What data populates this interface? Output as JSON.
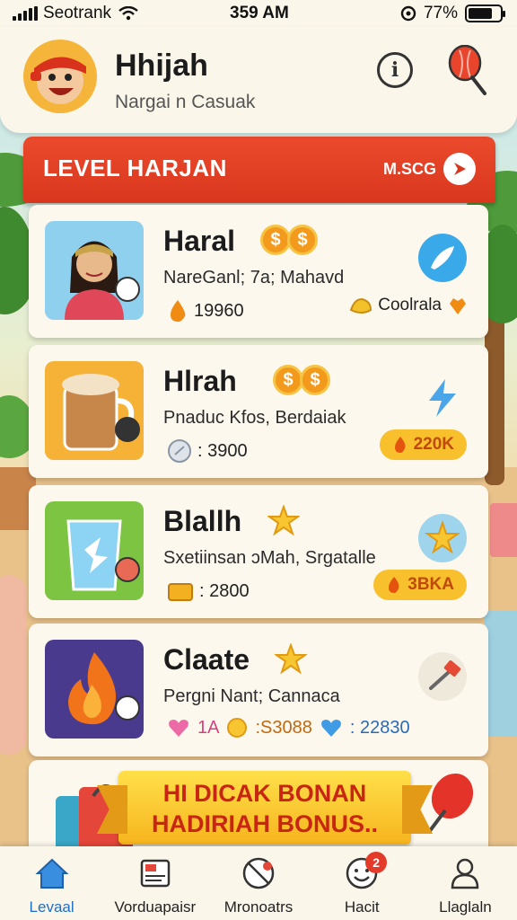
{
  "status_bar": {
    "carrier": "Seotrank",
    "time": "359 AM",
    "battery": "77%",
    "battery_level": 0.77
  },
  "header": {
    "title": "Hhijah",
    "subtitle": "Nargai n Casuak"
  },
  "level_banner": {
    "title": "LEVEL HARJAN",
    "more_label": "M.SCG"
  },
  "cards": [
    {
      "title": "Haral",
      "title_tokens": [
        "$",
        "$"
      ],
      "description": "NareGanl; 7a; Mahavd",
      "stat_value": "19960",
      "right_label": "Coolrala",
      "accent": "#2ea3e6"
    },
    {
      "title": "Hlrah",
      "title_tokens": [
        "$",
        "$"
      ],
      "description": "Pnaduc Kfos, Berdaiak",
      "stat_value": ": 3900",
      "right_label": "220K",
      "accent": "#f8c02c"
    },
    {
      "title": "Blallh",
      "description": "Sxetiinsan ɔMah, Srgatalle",
      "stat_value": ": 2800",
      "right_label": "3BKA",
      "accent": "#f8c02c"
    },
    {
      "title": "Claate",
      "description": "Pergni Nant; Cannaca",
      "stat_items": [
        "1A",
        ":S3088",
        ": 22830"
      ]
    }
  ],
  "bonus": {
    "line1": "HI DICAK BONAN",
    "line2": "HADIRIAH BONUS.."
  },
  "nav": [
    {
      "label": "Levaal",
      "active": true
    },
    {
      "label": "Vorduapaisr"
    },
    {
      "label": "Mronoatrs"
    },
    {
      "label": "Hacit",
      "badge": "2"
    },
    {
      "label": "Llaglaln"
    }
  ]
}
